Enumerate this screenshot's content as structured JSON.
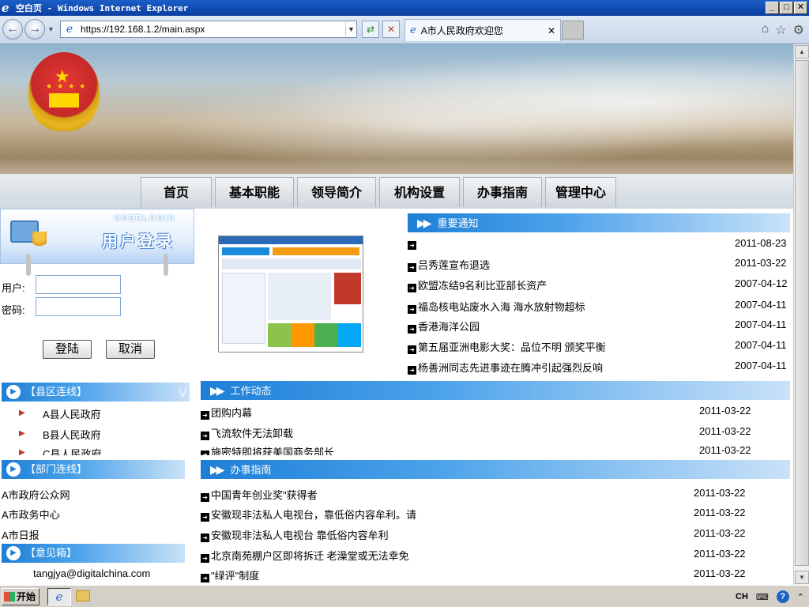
{
  "window": {
    "title": "空白页 - Windows Internet Explorer",
    "min": "_",
    "max": "□",
    "close": "✕"
  },
  "browser": {
    "url": "https://192.168.1.2/main.aspx",
    "tab_title": "A市人民政府欢迎您",
    "tab_close": "✕"
  },
  "nav": {
    "items": [
      "首页",
      "基本职能",
      "领导简介",
      "机构设置",
      "办事指南",
      "管理中心"
    ]
  },
  "login": {
    "header_en": "USERLOGIN",
    "header_cn": "用户登录",
    "user_label": "用户:",
    "pass_label": "密码:",
    "login_button": "登陆",
    "cancel_button": "取消"
  },
  "notices": {
    "title": "重要通知",
    "items": [
      {
        "text": "",
        "date": "2011-08-23"
      },
      {
        "text": "吕秀莲宣布退选",
        "date": "2011-03-22"
      },
      {
        "text": "欧盟冻结9名利比亚部长资产",
        "date": "2007-04-12"
      },
      {
        "text": "福岛核电站废水入海 海水放射物超标",
        "date": "2007-04-11"
      },
      {
        "text": "香港海洋公园",
        "date": "2007-04-11"
      },
      {
        "text": "第五届亚洲电影大奖：品位不明 颁奖平衡",
        "date": "2007-04-11"
      },
      {
        "text": "杨善洲同志先进事迹在腾冲引起强烈反响",
        "date": "2007-04-11"
      }
    ]
  },
  "county_links": {
    "title": "【县区连线】",
    "items": [
      "A县人民政府",
      "B县人民政府",
      "C县人民政府"
    ]
  },
  "work_news": {
    "title": "工作动态",
    "items": [
      {
        "text": "团购内幕",
        "date": "2011-03-22"
      },
      {
        "text": "飞流软件无法卸载",
        "date": "2011-03-22"
      },
      {
        "text": "施密特即将获美国商务部长",
        "date": "2011-03-22"
      }
    ]
  },
  "dept_links": {
    "title": "【部门连线】",
    "items": [
      "A市政府公众网",
      "A市政务中心",
      "A市日报"
    ]
  },
  "guide": {
    "title": "办事指南",
    "items": [
      {
        "text": "中国青年创业奖\"获得者",
        "date": "2011-03-22"
      },
      {
        "text": "安徽现非法私人电视台，靠低俗内容牟利。请",
        "date": "2011-03-22"
      },
      {
        "text": "安徽现非法私人电视台 靠低俗内容牟利",
        "date": "2011-03-22"
      },
      {
        "text": "北京南苑棚户区即将拆迁 老澡堂或无法幸免",
        "date": "2011-03-22"
      },
      {
        "text": "\"绿评\"制度",
        "date": "2011-03-22"
      }
    ]
  },
  "feedback": {
    "title": "【意见箱】",
    "email": "tangjya@digitalchina.com"
  },
  "taskbar": {
    "start": "开始",
    "lang": "CH"
  }
}
